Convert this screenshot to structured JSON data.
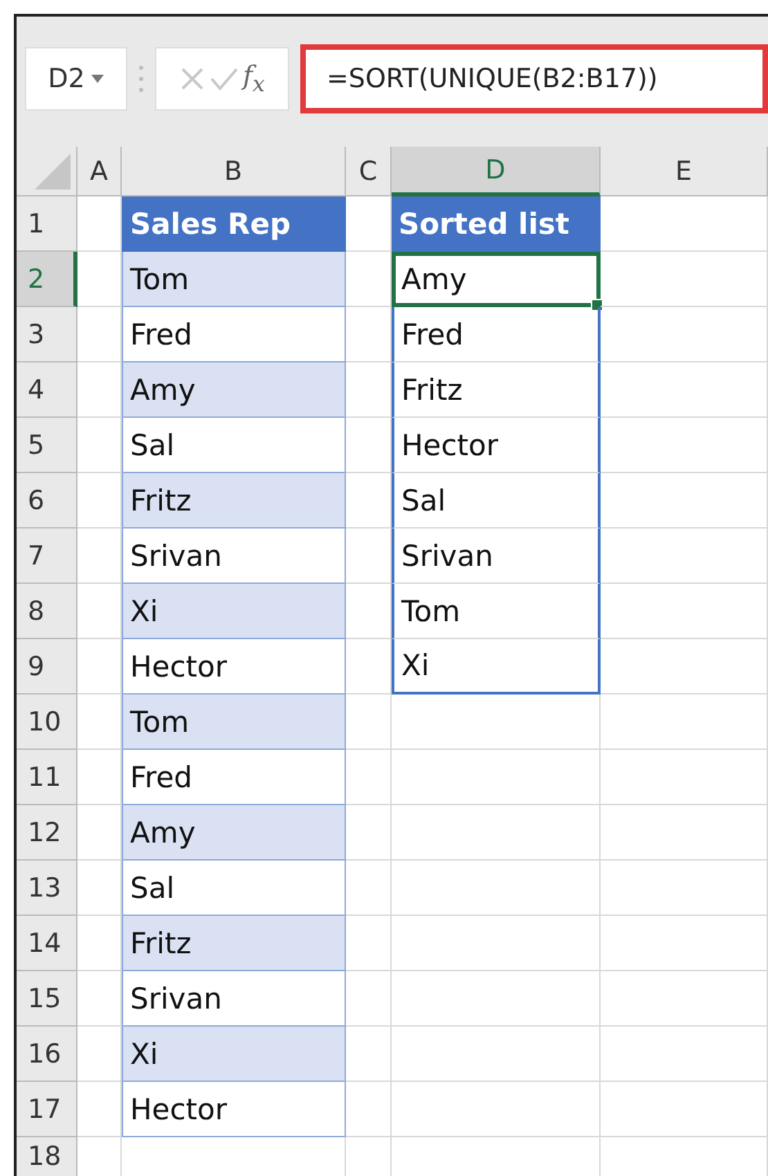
{
  "formula_bar": {
    "name_box": "D2",
    "function_button": "f$_{x}$",
    "formula": "=SORT(UNIQUE(B2:B17))",
    "formula_highlighted": true
  },
  "columns": [
    {
      "label": "A",
      "selected": false
    },
    {
      "label": "B",
      "selected": false
    },
    {
      "label": "C",
      "selected": false
    },
    {
      "label": "D",
      "selected": true
    },
    {
      "label": "E",
      "selected": false
    }
  ],
  "rows": [
    {
      "number": "1",
      "selected": false,
      "kind": "header",
      "sales_rep": "Sales Rep",
      "sorted_list": "Sorted list",
      "active": false
    },
    {
      "number": "2",
      "selected": true,
      "kind": "data",
      "sales_rep": "Tom",
      "sorted_list": "Amy",
      "active": true
    },
    {
      "number": "3",
      "selected": false,
      "kind": "data",
      "sales_rep": "Fred",
      "sorted_list": "Fred",
      "active": false
    },
    {
      "number": "4",
      "selected": false,
      "kind": "data",
      "sales_rep": "Amy",
      "sorted_list": "Fritz",
      "active": false
    },
    {
      "number": "5",
      "selected": false,
      "kind": "data",
      "sales_rep": "Sal",
      "sorted_list": "Hector",
      "active": false
    },
    {
      "number": "6",
      "selected": false,
      "kind": "data",
      "sales_rep": "Fritz",
      "sorted_list": "Sal",
      "active": false
    },
    {
      "number": "7",
      "selected": false,
      "kind": "data",
      "sales_rep": "Srivan",
      "sorted_list": "Srivan",
      "active": false
    },
    {
      "number": "8",
      "selected": false,
      "kind": "data",
      "sales_rep": "Xi",
      "sorted_list": "Tom",
      "active": false
    },
    {
      "number": "9",
      "selected": false,
      "kind": "data",
      "sales_rep": "Hector",
      "sorted_list": "Xi",
      "active": false
    },
    {
      "number": "10",
      "selected": false,
      "kind": "data",
      "sales_rep": "Tom",
      "active": false
    },
    {
      "number": "11",
      "selected": false,
      "kind": "data",
      "sales_rep": "Fred",
      "active": false
    },
    {
      "number": "12",
      "selected": false,
      "kind": "data",
      "sales_rep": "Amy",
      "active": false
    },
    {
      "number": "13",
      "selected": false,
      "kind": "data",
      "sales_rep": "Sal",
      "active": false
    },
    {
      "number": "14",
      "selected": false,
      "kind": "data",
      "sales_rep": "Fritz",
      "active": false
    },
    {
      "number": "15",
      "selected": false,
      "kind": "data",
      "sales_rep": "Srivan",
      "active": false
    },
    {
      "number": "16",
      "selected": false,
      "kind": "data",
      "sales_rep": "Xi",
      "active": false
    },
    {
      "number": "17",
      "selected": false,
      "kind": "data",
      "sales_rep": "Hector",
      "active": false
    },
    {
      "number": "18",
      "selected": false,
      "kind": "data",
      "active": false
    }
  ]
}
